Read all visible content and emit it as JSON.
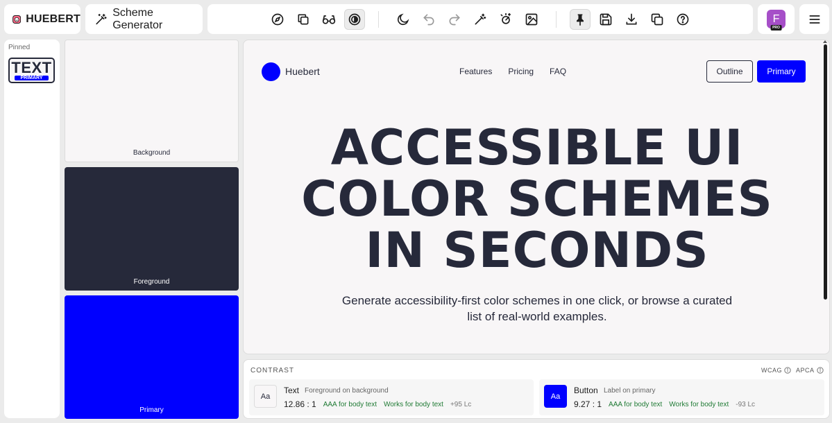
{
  "app": {
    "name": "HUEBERT"
  },
  "generator": {
    "label": "Scheme Generator"
  },
  "toolbar": {
    "icons": [
      "compass-icon",
      "copy-stack-icon",
      "glasses-icon",
      "contrast-icon",
      "moon-icon",
      "undo-icon",
      "redo-icon",
      "magic-wand-icon",
      "sparkle-icon",
      "image-icon",
      "pin-icon",
      "save-icon",
      "download-icon",
      "duplicate-icon",
      "help-icon"
    ]
  },
  "user": {
    "initial": "F",
    "badge": "PRO"
  },
  "pinned": {
    "title": "Pinned",
    "card": {
      "text": "TEXT",
      "tag": "PRIMARY"
    }
  },
  "swatches": [
    {
      "label": "Background",
      "color": "#f8f6f7"
    },
    {
      "label": "Foreground",
      "color": "#26293a"
    },
    {
      "label": "Primary",
      "color": "#0000ff"
    }
  ],
  "preview": {
    "brand": "Huebert",
    "nav": [
      "Features",
      "Pricing",
      "FAQ"
    ],
    "outline_button": "Outline",
    "primary_button": "Primary",
    "hero": [
      "ACCESSIBLE UI",
      "COLOR SCHEMES",
      "IN SECONDS"
    ],
    "subtitle": [
      "Generate accessibility-first color schemes in one click, or browse a curated",
      "list of real-world examples."
    ]
  },
  "contrast": {
    "title": "CONTRAST",
    "standards": [
      "WCAG",
      "APCA"
    ],
    "cards": [
      {
        "sample": "Aa",
        "name": "Text",
        "description": "Foreground on background",
        "ratio": "12.86 : 1",
        "wcag": "AAA for body text",
        "apca": "Works for body text",
        "lc": "+95 Lc"
      },
      {
        "sample": "Aa",
        "name": "Button",
        "description": "Label on primary",
        "ratio": "9.27 : 1",
        "wcag": "AAA for body text",
        "apca": "Works for body text",
        "lc": "-93 Lc"
      }
    ]
  }
}
